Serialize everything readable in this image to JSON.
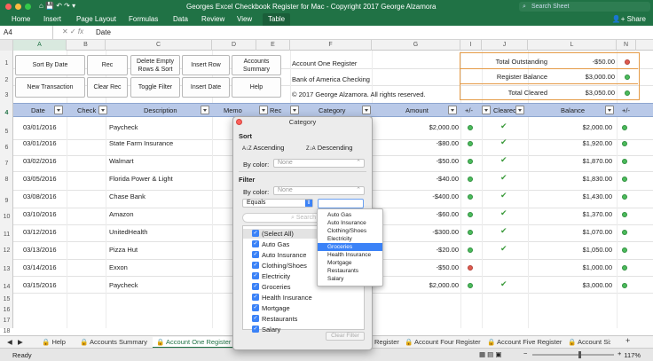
{
  "window": {
    "title": "Georges Excel Checkbook Register for Mac - Copyright 2017 George Alzamora",
    "search_placeholder": "Search Sheet",
    "traffic": {
      "close": "#fc605c",
      "minimize": "#fcbb40",
      "maximize": "#34c84a"
    }
  },
  "ribbon": {
    "tabs": [
      "Home",
      "Insert",
      "Page Layout",
      "Formulas",
      "Data",
      "Review",
      "View",
      "Table"
    ],
    "active": "Table",
    "share": "Share"
  },
  "formula": {
    "namebox": "A4",
    "fx": "fx",
    "value": "Date"
  },
  "columns": [
    "A",
    "B",
    "C",
    "D",
    "E",
    "F",
    "G",
    "I",
    "J",
    "L",
    "N"
  ],
  "rows": [
    "1",
    "2",
    "3",
    "4",
    "5",
    "6",
    "7",
    "8",
    "9",
    "10",
    "11",
    "12",
    "13",
    "14",
    "15",
    "16",
    "17",
    "18",
    "19",
    "20"
  ],
  "buttons": {
    "sort_by_date": "Sort By Date",
    "rec": "Rec",
    "delete_empty": "Delete Empty Rows & Sort",
    "insert_row": "Insert Row",
    "accounts_summary": "Accounts Summary",
    "new_transaction": "New Transaction",
    "clear_rec": "Clear Rec",
    "toggle_filter": "Toggle Filter",
    "insert_date": "Insert Date",
    "help": "Help"
  },
  "info": {
    "register": "Account One Register",
    "bank": "Bank of America Checking",
    "copyright": "© 2017 George Alzamora.  All rights reserved."
  },
  "summary": [
    {
      "label": "Total Outstanding",
      "value": "-$50.00",
      "status": "red"
    },
    {
      "label": "Register Balance",
      "value": "$3,000.00",
      "status": "green"
    },
    {
      "label": "Total Cleared",
      "value": "$3,050.00",
      "status": "green"
    }
  ],
  "table": {
    "headers": [
      "Date",
      "Check",
      "Description",
      "Memo",
      "Rec",
      "Category",
      "Amount",
      "+/-",
      "Cleared",
      "Balance",
      "+/-"
    ],
    "rows": [
      {
        "date": "03/01/2016",
        "desc": "Paycheck",
        "amount": "$2,000.00",
        "status": "green",
        "cleared": true,
        "balance": "$2,000.00"
      },
      {
        "date": "03/01/2016",
        "desc": "State Farm Insurance",
        "amount": "-$80.00",
        "status": "green",
        "cleared": true,
        "balance": "$1,920.00"
      },
      {
        "date": "03/02/2016",
        "desc": "Walmart",
        "amount": "-$50.00",
        "status": "green",
        "cleared": true,
        "balance": "$1,870.00"
      },
      {
        "date": "03/05/2016",
        "desc": "Florida Power & Light",
        "amount": "-$40.00",
        "status": "green",
        "cleared": true,
        "balance": "$1,830.00"
      },
      {
        "date": "03/08/2016",
        "desc": "Chase Bank",
        "amount": "-$400.00",
        "status": "green",
        "cleared": true,
        "balance": "$1,430.00"
      },
      {
        "date": "03/10/2016",
        "desc": "Amazon",
        "amount": "-$60.00",
        "status": "green",
        "cleared": true,
        "balance": "$1,370.00"
      },
      {
        "date": "03/12/2016",
        "desc": "UnitedHealth",
        "amount": "-$300.00",
        "status": "green",
        "cleared": true,
        "balance": "$1,070.00"
      },
      {
        "date": "03/13/2016",
        "desc": "Pizza Hut",
        "amount": "-$20.00",
        "status": "green",
        "cleared": true,
        "balance": "$1,050.00"
      },
      {
        "date": "03/14/2016",
        "desc": "Exxon",
        "amount": "-$50.00",
        "status": "red",
        "cleared": false,
        "balance": "$1,000.00"
      },
      {
        "date": "03/15/2016",
        "desc": "Paycheck",
        "amount": "$2,000.00",
        "status": "green",
        "cleared": true,
        "balance": "$3,000.00"
      }
    ]
  },
  "dialog": {
    "title": "Category",
    "sort_label": "Sort",
    "ascending": "Ascending",
    "descending": "Descending",
    "by_color": "By color:",
    "none": "None",
    "filter_label": "Filter",
    "filter_by_color": "By color:",
    "filter_none": "None",
    "equals": "Equals",
    "search": "Search",
    "clear_filter": "Clear Filter",
    "items": [
      "(Select All)",
      "Auto Gas",
      "Auto Insurance",
      "Clothing/Shoes",
      "Electricity",
      "Groceries",
      "Health Insurance",
      "Mortgage",
      "Restaurants",
      "Salary"
    ]
  },
  "dropdown": {
    "options": [
      "Auto Gas",
      "Auto Insurance",
      "Clothing/Shoes",
      "Electricity",
      "Groceries",
      "Health Insurance",
      "Mortgage",
      "Restaurants",
      "Salary"
    ],
    "highlighted": "Groceries"
  },
  "sheets": {
    "tabs": [
      "Help",
      "Accounts Summary",
      "Account One Register",
      "Register",
      "Account Four Register",
      "Account Five Register",
      "Account Six"
    ],
    "active": "Account One Register",
    "add": "+"
  },
  "status": {
    "ready": "Ready",
    "zoom": "117%"
  }
}
